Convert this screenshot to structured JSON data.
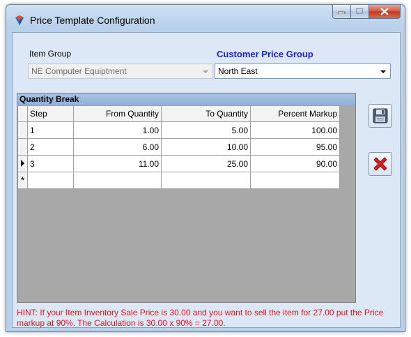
{
  "window": {
    "title": "Price Template Configuration"
  },
  "form": {
    "item_group_label": "Item Group",
    "item_group_value": "NE Computer Equiptment",
    "customer_price_group_label": "Customer Price Group",
    "customer_price_group_value": "North East"
  },
  "grid": {
    "caption": "Quantity Break",
    "columns": [
      "Step",
      "From Quantity",
      "To Quantity",
      "Percent Markup"
    ],
    "rows": [
      {
        "step": "1",
        "from": "1.00",
        "to": "5.00",
        "markup": "100.00"
      },
      {
        "step": "2",
        "from": "6.00",
        "to": "10.00",
        "markup": "95.00"
      },
      {
        "step": "3",
        "from": "11.00",
        "to": "25.00",
        "markup": "90.00"
      }
    ],
    "new_row_marker": "*"
  },
  "icons": {
    "app": "shield-icon",
    "save": "floppy-disk-icon",
    "cancel": "red-x-icon"
  },
  "colors": {
    "accent_label": "#1d20e4",
    "hint": "#e3101a"
  },
  "hint": "HINT: If your Item Inventory Sale Price is 30.00 and you want to sell the item for 27.00 put the Price markup at 90%. The Calculation is 30.00 x 90% = 27.00."
}
